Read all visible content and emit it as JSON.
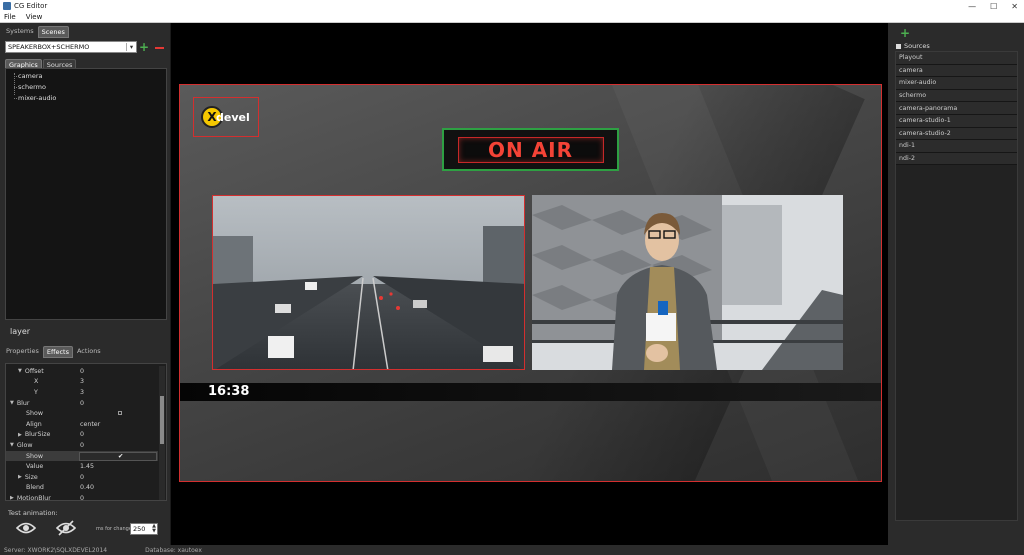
{
  "window": {
    "title": "CG Editor"
  },
  "menu": [
    "File",
    "View"
  ],
  "left": {
    "top_tabs": [
      "Systems",
      "Scenes"
    ],
    "scene_select": "SPEAKERBOX+SCHERMO",
    "sub_tabs": [
      "Graphics",
      "Sources"
    ],
    "tree_items": [
      "camera",
      "schermo",
      "mixer-audio"
    ],
    "layer_title": "layer",
    "prop_tabs": [
      "Properties",
      "Effects",
      "Actions"
    ],
    "properties": [
      {
        "name": "Offset",
        "value": "0",
        "level": 1,
        "expander": "down"
      },
      {
        "name": "X",
        "value": "3",
        "level": 3,
        "expander": ""
      },
      {
        "name": "Y",
        "value": "3",
        "level": 3,
        "expander": ""
      },
      {
        "name": "Blur",
        "value": "0",
        "level": 0,
        "expander": "down"
      },
      {
        "name": "Show",
        "value": "",
        "level": 2,
        "expander": ""
      },
      {
        "name": "Align",
        "value": "center",
        "level": 2,
        "expander": ""
      },
      {
        "name": "BlurSize",
        "value": "0",
        "level": 1,
        "expander": "right"
      },
      {
        "name": "Glow",
        "value": "0",
        "level": 0,
        "expander": "down"
      },
      {
        "name": "Show",
        "value": "✔",
        "level": 2,
        "expander": ""
      },
      {
        "name": "Value",
        "value": "1.45",
        "level": 2,
        "expander": ""
      },
      {
        "name": "Size",
        "value": "0",
        "level": 1,
        "expander": "right"
      },
      {
        "name": "Blend",
        "value": "0.40",
        "level": 2,
        "expander": ""
      },
      {
        "name": "MotionBlur",
        "value": "0",
        "level": 0,
        "expander": "right"
      }
    ],
    "test_animation_label": "Test animation:",
    "ms_label": "ms for change",
    "ms_value": "250"
  },
  "preview": {
    "logo_text": "devel",
    "logo_mark": "X",
    "on_air": "ON AIR",
    "clock": "16:38"
  },
  "right": {
    "sources_header": "Sources",
    "sources": [
      "Playout",
      "camera",
      "mixer-audio",
      "schermo",
      "camera-panorama",
      "camera-studio-1",
      "camera-studio-2",
      "ndi-1",
      "ndi-2"
    ]
  },
  "status": {
    "server": "Server: XWORK2\\SQLXDEVEL2014",
    "database": "Database: xautoex"
  },
  "colors": {
    "accent_red": "#d32f2f",
    "accent_green": "#2ea043",
    "add_green": "#4caf50"
  }
}
